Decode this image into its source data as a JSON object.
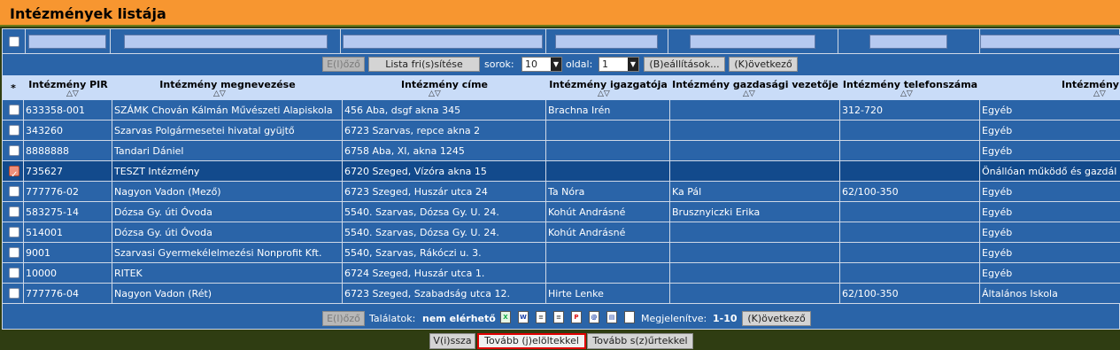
{
  "title": "Intézmények listája",
  "pager_top": {
    "prev": "E(l)őző",
    "refresh": "Lista fri(s)sítése",
    "rows_label": "sorok:",
    "rows_value": "10",
    "page_label": "oldal:",
    "page_value": "1",
    "settings": "(B)eállítások...",
    "next": "(K)övetkező"
  },
  "columns": {
    "star": "*",
    "pir": "Intézmény PIR",
    "name": "Intézmény megnevezése",
    "address": "Intézmény címe",
    "director": "Intézmény igazgatója",
    "finance": "Intézmény gazdasági vezetője",
    "phone": "Intézmény telefonszáma",
    "type": "Intézmény"
  },
  "rows": [
    {
      "pir": "633358-001",
      "name": "SZÁMK Chován Kálmán Művészeti Alapiskola",
      "address": "456 Aba, dsgf akna 345",
      "director": "Brachna Irén",
      "finance": "",
      "phone": "312-720",
      "type": "Egyéb",
      "checked": false
    },
    {
      "pir": "343260",
      "name": "Szarvas Polgármesetei hivatal gyüjtő",
      "address": "6723 Szarvas, repce akna 2",
      "director": "",
      "finance": "",
      "phone": "",
      "type": "Egyéb",
      "checked": false
    },
    {
      "pir": "8888888",
      "name": "Tandari Dániel",
      "address": "6758 Aba, XI, akna 1245",
      "director": "",
      "finance": "",
      "phone": "",
      "type": "Egyéb",
      "checked": false
    },
    {
      "pir": "735627",
      "name": "TESZT Intézmény",
      "address": "6720 Szeged, Vízóra akna 15",
      "director": "",
      "finance": "",
      "phone": "",
      "type": "Önállóan működő és gazdál",
      "checked": true
    },
    {
      "pir": "777776-02",
      "name": "Nagyon Vadon (Mező)",
      "address": "6723 Szeged, Huszár utca 24",
      "director": "Ta Nóra",
      "finance": "Ka Pál",
      "phone": "62/100-350",
      "type": "Egyéb",
      "checked": false
    },
    {
      "pir": "583275-14",
      "name": "Dózsa Gy. úti Óvoda",
      "address": "5540. Szarvas, Dózsa Gy. U. 24.",
      "director": "Kohút Andrásné",
      "finance": "Brusznyiczki Erika",
      "phone": "",
      "type": "Egyéb",
      "checked": false
    },
    {
      "pir": "514001",
      "name": "Dózsa Gy. úti Óvoda",
      "address": "5540. Szarvas, Dózsa Gy. U. 24.",
      "director": "Kohút Andrásné",
      "finance": "",
      "phone": "",
      "type": "Egyéb",
      "checked": false
    },
    {
      "pir": "9001",
      "name": "Szarvasi Gyermekélelmezési Nonprofit Kft.",
      "address": "5540, Szarvas, Rákóczi u. 3.",
      "director": "",
      "finance": "",
      "phone": "",
      "type": "Egyéb",
      "checked": false
    },
    {
      "pir": "10000",
      "name": "RITEK",
      "address": "6724 Szeged, Huszár utca 1.",
      "director": "",
      "finance": "",
      "phone": "",
      "type": "Egyéb",
      "checked": false
    },
    {
      "pir": "777776-04",
      "name": "Nagyon Vadon (Rét)",
      "address": "6723 Szeged, Szabadság utca 12.",
      "director": "Hirte Lenke",
      "finance": "",
      "phone": "62/100-350",
      "type": "Általános Iskola",
      "checked": false
    }
  ],
  "pager_bottom": {
    "prev": "E(l)őző",
    "results_label": "Találatok:",
    "results_value": "nem elérhető",
    "shown_label": "Megjelenítve:",
    "shown_value": "1-10",
    "next": "(K)övetkező"
  },
  "export_icons": [
    "excel-icon",
    "word-icon",
    "text-icon",
    "document-icon",
    "pdf-icon",
    "email-icon",
    "print-icon",
    "blank-page-icon"
  ],
  "bottom_buttons": {
    "back": "V(i)ssza",
    "next_checked": "Tovább (j)elöltekkel",
    "next_filtered": "Tovább s(z)űrtekkel"
  }
}
